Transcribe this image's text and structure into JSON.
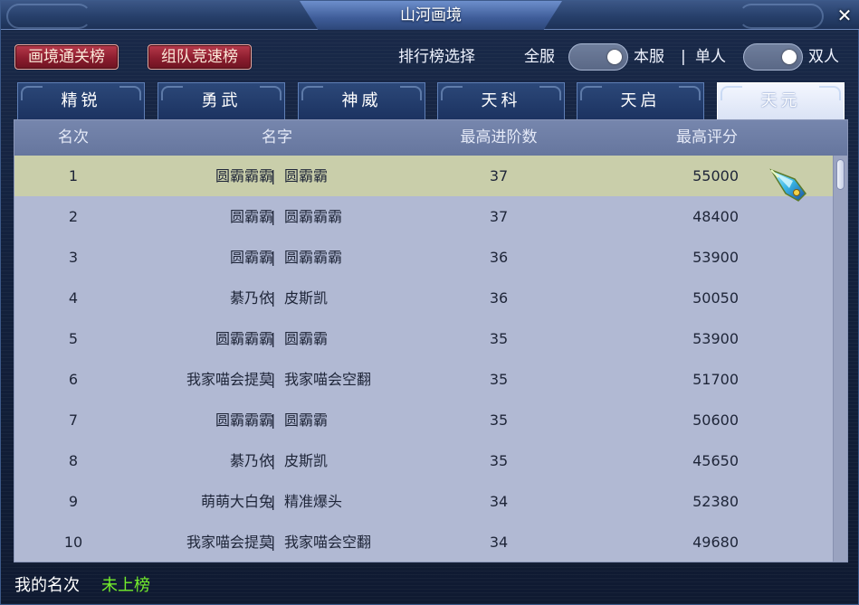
{
  "window": {
    "title": "山河画境",
    "close_glyph": "✕"
  },
  "toolbar": {
    "btn_clear": "画境通关榜",
    "btn_speed": "组队竞速榜",
    "rank_select_label": "排行榜选择",
    "opt_all_server": "全服",
    "opt_this_server": "本服",
    "separator": "|",
    "opt_single": "单人",
    "opt_duo": "双人"
  },
  "tabs": [
    {
      "label": "精锐",
      "active": false
    },
    {
      "label": "勇武",
      "active": false
    },
    {
      "label": "神威",
      "active": false
    },
    {
      "label": "天科",
      "active": false
    },
    {
      "label": "天启",
      "active": false
    },
    {
      "label": "天元",
      "active": true
    }
  ],
  "table": {
    "headers": {
      "rank": "名次",
      "name": "名字",
      "stage": "最高进阶数",
      "score": "最高评分"
    },
    "name_separator": "|",
    "rows": [
      {
        "rank": "1",
        "name_left": "圆霸霸霸",
        "name_right": "圆霸霸",
        "stage": "37",
        "score": "55000",
        "selected": true
      },
      {
        "rank": "2",
        "name_left": "圆霸霸",
        "name_right": "圆霸霸霸",
        "stage": "37",
        "score": "48400"
      },
      {
        "rank": "3",
        "name_left": "圆霸霸",
        "name_right": "圆霸霸霸",
        "stage": "36",
        "score": "53900"
      },
      {
        "rank": "4",
        "name_left": "綦乃依",
        "name_right": "皮斯凯",
        "stage": "36",
        "score": "50050"
      },
      {
        "rank": "5",
        "name_left": "圆霸霸霸",
        "name_right": "圆霸霸",
        "stage": "35",
        "score": "53900"
      },
      {
        "rank": "6",
        "name_left": "我家喵会提莫",
        "name_right": "我家喵会空翻",
        "stage": "35",
        "score": "51700"
      },
      {
        "rank": "7",
        "name_left": "圆霸霸霸",
        "name_right": "圆霸霸",
        "stage": "35",
        "score": "50600"
      },
      {
        "rank": "8",
        "name_left": "綦乃依",
        "name_right": "皮斯凯",
        "stage": "35",
        "score": "45650"
      },
      {
        "rank": "9",
        "name_left": "萌萌大白兔",
        "name_right": "精准爆头",
        "stage": "34",
        "score": "52380"
      },
      {
        "rank": "10",
        "name_left": "我家喵会提莫",
        "name_right": "我家喵会空翻",
        "stage": "34",
        "score": "49680"
      }
    ]
  },
  "footer": {
    "my_rank_label": "我的名次",
    "my_rank_value": "未上榜"
  },
  "colors": {
    "accent_green": "#74ef2c",
    "row_selected": "#c9ceaa",
    "panel_bg": "#b1b9d3",
    "header_bg": "#6e7ea6",
    "button_red": "#8c1d2e"
  }
}
